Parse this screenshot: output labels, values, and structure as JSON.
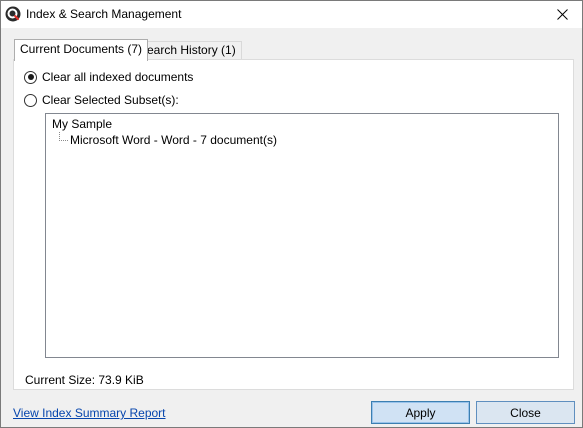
{
  "window": {
    "title": "Index & Search Management"
  },
  "tabs": [
    {
      "label": "Current Documents (7)",
      "active": true
    },
    {
      "label": "Search History (1)",
      "active": false
    }
  ],
  "options": {
    "clear_all_label": "Clear all indexed documents",
    "clear_all_checked": true,
    "clear_subset_label": "Clear Selected Subset(s):",
    "clear_subset_checked": false
  },
  "tree": {
    "root_label": "My Sample",
    "children": [
      {
        "label": "Microsoft Word - Word - 7 document(s)"
      }
    ]
  },
  "status": {
    "current_size": "Current Size: 73.9 KiB"
  },
  "footer": {
    "summary_link": "View Index Summary Report",
    "apply_label": "Apply",
    "close_label": "Close"
  },
  "colors": {
    "accent": "#3c7fb1",
    "link": "#0645ad",
    "app_icon_red": "#e0312b"
  },
  "icons": {
    "app": "magnifier-logo-icon",
    "close": "close-icon"
  }
}
